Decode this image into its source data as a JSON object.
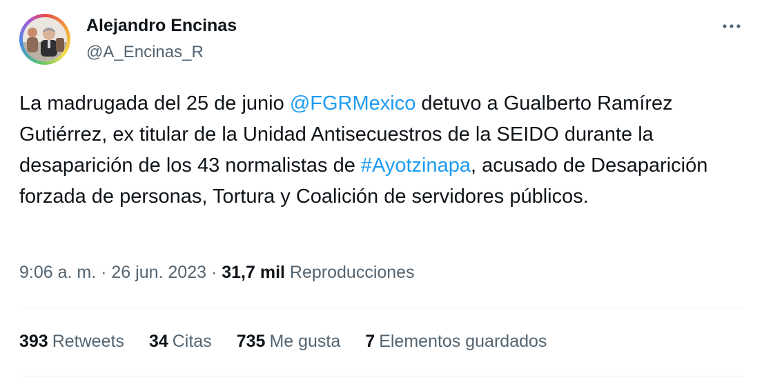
{
  "author": {
    "name": "Alejandro Encinas",
    "handle": "@A_Encinas_R"
  },
  "tweet": {
    "segments": [
      {
        "text": "La madrugada del 25 de junio ",
        "type": "text"
      },
      {
        "text": "@FGRMexico",
        "type": "mention"
      },
      {
        "text": " detuvo a Gualberto Ramírez Gutiérrez, ex titular de la Unidad Antisecuestros de la SEIDO durante la desaparición de los 43 normalistas de ",
        "type": "text"
      },
      {
        "text": "#Ayotzinapa",
        "type": "hashtag"
      },
      {
        "text": ", acusado de Desaparición forzada de personas, Tortura y Coalición de servidores públicos.",
        "type": "text"
      }
    ]
  },
  "meta": {
    "time": "9:06 a. m.",
    "separator": " · ",
    "date": "26 jun. 2023",
    "views_count": "31,7 mil",
    "views_label": "Reproducciones"
  },
  "stats": [
    {
      "count": "393",
      "label": "Retweets"
    },
    {
      "count": "34",
      "label": "Citas"
    },
    {
      "count": "735",
      "label": "Me gusta"
    },
    {
      "count": "7",
      "label": "Elementos guardados"
    }
  ],
  "colors": {
    "link": "#1d9bf0",
    "text": "#0f1419",
    "secondary": "#536471",
    "divider": "#eff3f4"
  },
  "icons": {
    "more": "more-horizontal-icon"
  }
}
